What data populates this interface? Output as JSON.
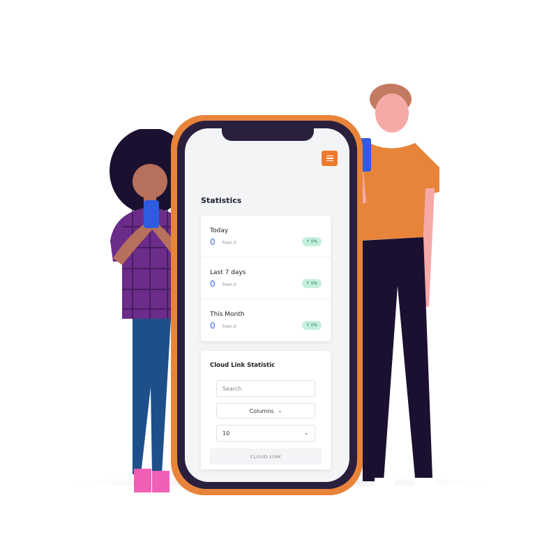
{
  "header": {
    "menu_icon": "hamburger-icon",
    "accent": "#ee7a2e"
  },
  "statistics": {
    "title": "Statistics",
    "rows": [
      {
        "label": "Today",
        "value": "0",
        "from": "from 0",
        "change": "↑ 0%"
      },
      {
        "label": "Last 7 days",
        "value": "0",
        "from": "from 0",
        "change": "↑ 0%"
      },
      {
        "label": "This Month",
        "value": "0",
        "from": "from 0",
        "change": "↑ 0%"
      }
    ]
  },
  "cloud": {
    "title": "Cloud Link Statistic",
    "search_placeholder": "Search",
    "columns_label": "Columns",
    "page_size": "10",
    "column_header": "CLOUD LINK"
  },
  "colors": {
    "phone_frame": "#e8843a",
    "value_blue": "#3b6cf0",
    "badge_green": "#c4efdc"
  }
}
